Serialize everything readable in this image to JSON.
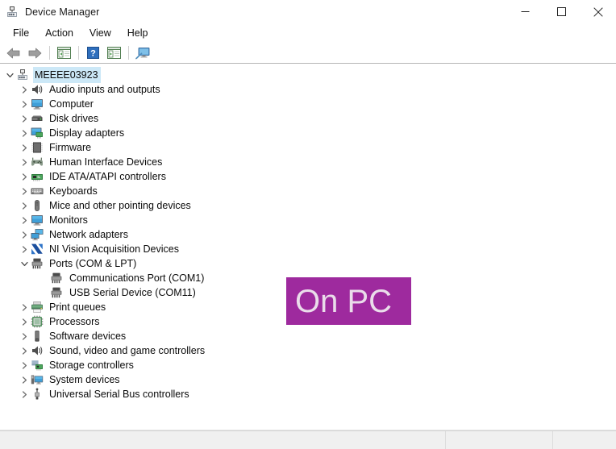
{
  "window": {
    "title": "Device Manager",
    "icon": "device-manager-icon",
    "caption_buttons": [
      {
        "name": "minimize-button",
        "glyph": "minimize-icon",
        "label": "Minimize"
      },
      {
        "name": "maximize-button",
        "glyph": "maximize-icon",
        "label": "Maximize"
      },
      {
        "name": "close-button",
        "glyph": "close-icon",
        "label": "Close"
      }
    ]
  },
  "menubar": {
    "items": [
      {
        "label": "File",
        "name": "menu-file"
      },
      {
        "label": "Action",
        "name": "menu-action"
      },
      {
        "label": "View",
        "name": "menu-view"
      },
      {
        "label": "Help",
        "name": "menu-help"
      }
    ]
  },
  "toolbar": {
    "buttons": [
      {
        "name": "back-button",
        "icon": "back-arrow-icon",
        "label": "Back"
      },
      {
        "name": "forward-button",
        "icon": "forward-arrow-icon",
        "label": "Forward"
      },
      {
        "name": "show-hide-console-tree-button",
        "icon": "console-tree-icon",
        "label": "Show/Hide Console Tree"
      },
      {
        "name": "help-button",
        "icon": "help-question-icon",
        "label": "Help"
      },
      {
        "name": "properties-button",
        "icon": "properties-icon",
        "label": "Properties"
      },
      {
        "name": "scan-hardware-changes-button",
        "icon": "scan-hardware-icon",
        "label": "Scan for hardware changes"
      }
    ]
  },
  "tree": {
    "root": {
      "label": "MEEEE03923",
      "icon": "computer-node-icon",
      "expanded": true,
      "selected": true
    },
    "items": [
      {
        "label": "Audio inputs and outputs",
        "icon": "speaker-icon",
        "expanded": false,
        "level": 1
      },
      {
        "label": "Computer",
        "icon": "monitor-icon",
        "expanded": false,
        "level": 1
      },
      {
        "label": "Disk drives",
        "icon": "disk-drive-icon",
        "expanded": false,
        "level": 1
      },
      {
        "label": "Display adapters",
        "icon": "display-adapter-icon",
        "expanded": false,
        "level": 1
      },
      {
        "label": "Firmware",
        "icon": "firmware-chip-icon",
        "expanded": false,
        "level": 1
      },
      {
        "label": "Human Interface Devices",
        "icon": "hid-gamepad-icon",
        "expanded": false,
        "level": 1
      },
      {
        "label": "IDE ATA/ATAPI controllers",
        "icon": "ide-controller-icon",
        "expanded": false,
        "level": 1
      },
      {
        "label": "Keyboards",
        "icon": "keyboard-icon",
        "expanded": false,
        "level": 1
      },
      {
        "label": "Mice and other pointing devices",
        "icon": "mouse-icon",
        "expanded": false,
        "level": 1
      },
      {
        "label": "Monitors",
        "icon": "monitor-icon",
        "expanded": false,
        "level": 1
      },
      {
        "label": "Network adapters",
        "icon": "network-adapter-icon",
        "expanded": false,
        "level": 1
      },
      {
        "label": "NI Vision Acquisition Devices",
        "icon": "ni-vision-icon",
        "expanded": false,
        "level": 1
      },
      {
        "label": "Ports (COM & LPT)",
        "icon": "port-icon",
        "expanded": true,
        "level": 1
      },
      {
        "label": "Communications Port (COM1)",
        "icon": "port-icon",
        "expanded": null,
        "level": 2
      },
      {
        "label": "USB Serial Device (COM11)",
        "icon": "port-icon",
        "expanded": null,
        "level": 2
      },
      {
        "label": "Print queues",
        "icon": "printer-icon",
        "expanded": false,
        "level": 1
      },
      {
        "label": "Processors",
        "icon": "processor-icon",
        "expanded": false,
        "level": 1
      },
      {
        "label": "Software devices",
        "icon": "software-device-icon",
        "expanded": false,
        "level": 1
      },
      {
        "label": "Sound, video and game controllers",
        "icon": "speaker-icon",
        "expanded": false,
        "level": 1
      },
      {
        "label": "Storage controllers",
        "icon": "storage-controller-icon",
        "expanded": false,
        "level": 1
      },
      {
        "label": "System devices",
        "icon": "system-device-icon",
        "expanded": false,
        "level": 1
      },
      {
        "label": "Universal Serial Bus controllers",
        "icon": "usb-controller-icon",
        "expanded": false,
        "level": 1
      }
    ]
  },
  "overlay": {
    "badge_text": "On PC",
    "background_color": "#9e2a9e",
    "text_color": "#eadcea"
  },
  "statusbar": {
    "panes": [
      {
        "name": "status-pane-main",
        "text": ""
      },
      {
        "name": "status-pane-secondary",
        "text": ""
      },
      {
        "name": "status-pane-tertiary",
        "text": ""
      }
    ]
  },
  "colors": {
    "selection": "#cce8f7",
    "window_background": "#ffffff",
    "statusbar_background": "#f0f0f0",
    "accent_purple": "#9e2a9e"
  }
}
